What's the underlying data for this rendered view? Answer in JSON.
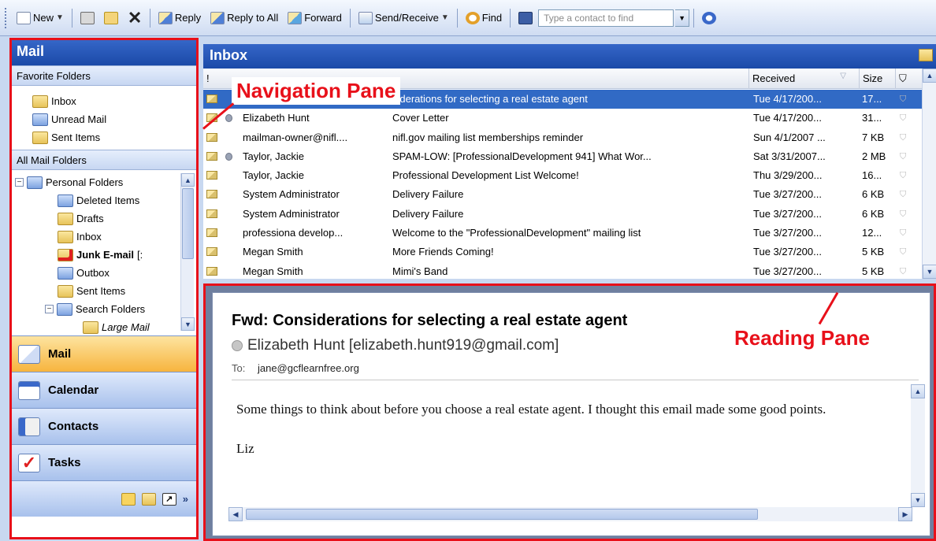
{
  "toolbar": {
    "new_label": "New",
    "reply_label": "Reply",
    "reply_all_label": "Reply to All",
    "forward_label": "Forward",
    "send_receive_label": "Send/Receive",
    "find_label": "Find",
    "contact_placeholder": "Type a contact to find"
  },
  "nav": {
    "title": "Mail",
    "favorites_header": "Favorite Folders",
    "favorites": [
      "Inbox",
      "Unread Mail",
      "Sent Items"
    ],
    "all_header": "All Mail Folders",
    "tree": {
      "root": "Personal Folders",
      "deleted": "Deleted Items",
      "drafts": "Drafts",
      "inbox": "Inbox",
      "junk": "Junk E-mail",
      "junk_suffix": "[:",
      "outbox": "Outbox",
      "sent": "Sent Items",
      "search": "Search Folders",
      "large": "Large Mail"
    },
    "buttons": [
      "Mail",
      "Calendar",
      "Contacts",
      "Tasks"
    ]
  },
  "inbox": {
    "title": "Inbox",
    "columns": {
      "received": "Received",
      "size": "Size"
    },
    "rows": [
      {
        "from": "",
        "subject": "siderations for selecting a real estate agent",
        "received": "Tue 4/17/200...",
        "size": "17...",
        "attach": false
      },
      {
        "from": "Elizabeth Hunt",
        "subject": "Cover Letter",
        "received": "Tue 4/17/200...",
        "size": "31...",
        "attach": true
      },
      {
        "from": "mailman-owner@nifl....",
        "subject": "nifl.gov mailing list memberships reminder",
        "received": "Sun 4/1/2007 ...",
        "size": "7 KB",
        "attach": false
      },
      {
        "from": "Taylor, Jackie",
        "subject": "SPAM-LOW:  [ProfessionalDevelopment 941] What Wor...",
        "received": "Sat 3/31/2007...",
        "size": "2 MB",
        "attach": true
      },
      {
        "from": "Taylor, Jackie",
        "subject": "Professional Development List Welcome!",
        "received": "Thu 3/29/200...",
        "size": "16...",
        "attach": false
      },
      {
        "from": "System Administrator",
        "subject": "Delivery Failure",
        "received": "Tue 3/27/200...",
        "size": "6 KB",
        "attach": false
      },
      {
        "from": "System Administrator",
        "subject": "Delivery Failure",
        "received": "Tue 3/27/200...",
        "size": "6 KB",
        "attach": false
      },
      {
        "from": "professiona develop...",
        "subject": "Welcome to the \"ProfessionalDevelopment\" mailing list",
        "received": "Tue 3/27/200...",
        "size": "12...",
        "attach": false
      },
      {
        "from": "Megan Smith",
        "subject": "More Friends Coming!",
        "received": "Tue 3/27/200...",
        "size": "5 KB",
        "attach": false
      },
      {
        "from": "Megan Smith",
        "subject": "Mimi's Band",
        "received": "Tue 3/27/200...",
        "size": "5 KB",
        "attach": false
      }
    ]
  },
  "reading": {
    "subject": "Fwd: Considerations for selecting a real estate agent",
    "from": "Elizabeth Hunt [elizabeth.hunt919@gmail.com]",
    "to_label": "To:",
    "to": "jane@gcflearnfree.org",
    "body_p1": "Some things to think about before you choose a real estate agent. I thought this email made some good points.",
    "body_p2": "Liz"
  },
  "annotations": {
    "navigation": "Navigation Pane",
    "reading": "Reading Pane"
  },
  "colors": {
    "accent": "#e8101a",
    "header_blue": "#1b4aa8",
    "selection": "#316ac5",
    "active_nav": "#f7b43e"
  }
}
